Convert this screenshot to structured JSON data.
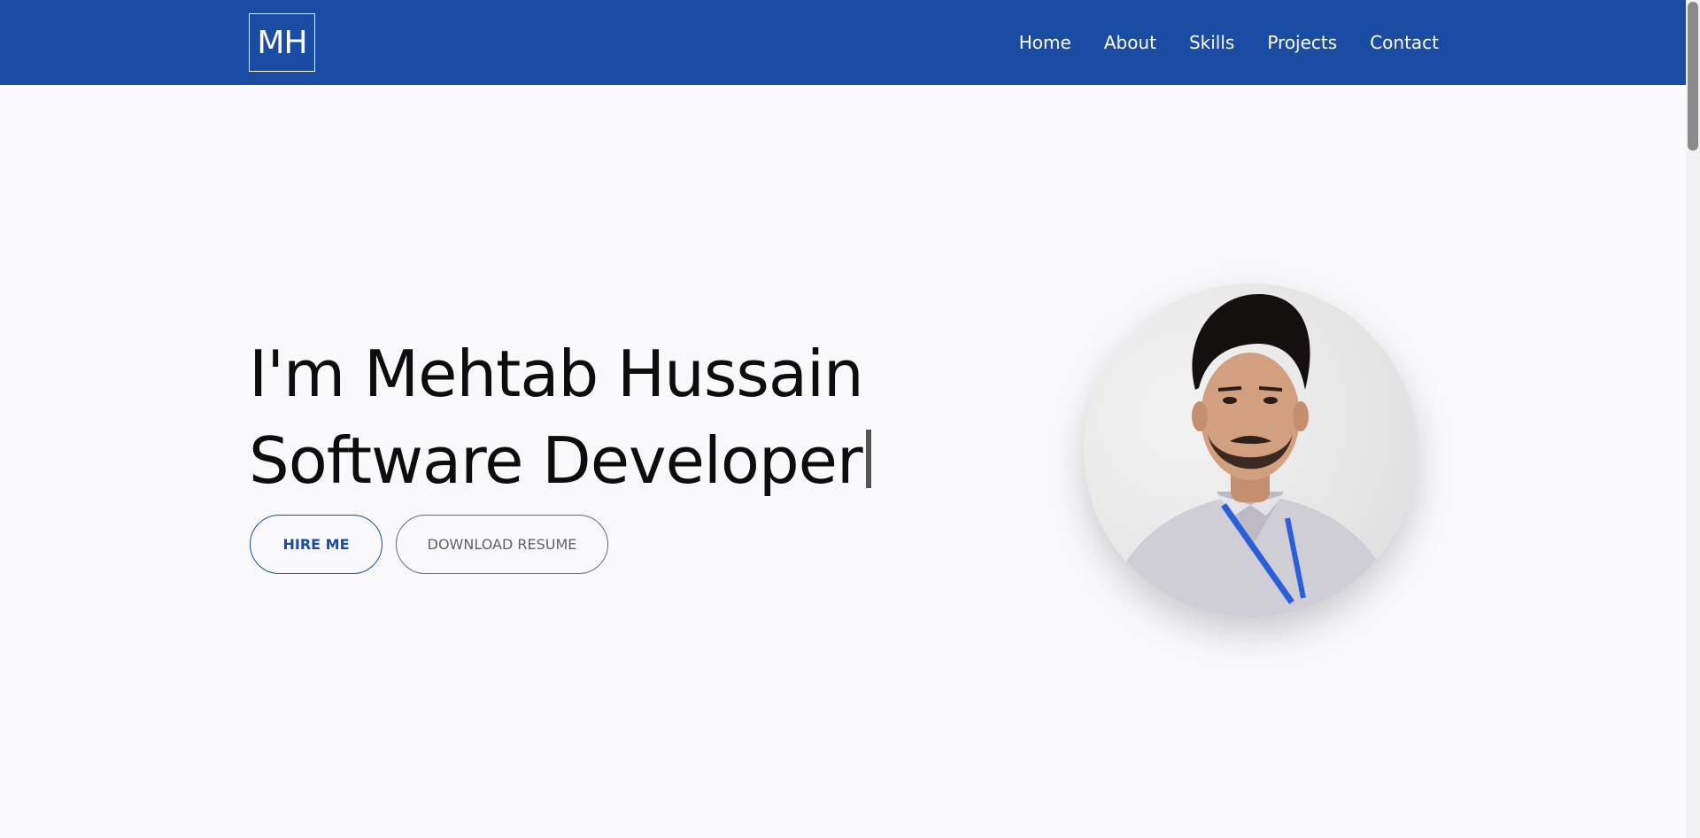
{
  "header": {
    "logo_text": "MH",
    "nav": [
      {
        "label": "Home"
      },
      {
        "label": "About"
      },
      {
        "label": "Skills"
      },
      {
        "label": "Projects"
      },
      {
        "label": "Contact"
      }
    ]
  },
  "hero": {
    "title_line1": "I'm Mehtab Hussain",
    "title_line2": "Software Developer",
    "hire_label": "HIRE ME",
    "resume_label": "DOWNLOAD RESUME"
  },
  "colors": {
    "brand": "#1a4ca3",
    "background": "#f9f9fb",
    "text": "#0d0d0d"
  }
}
